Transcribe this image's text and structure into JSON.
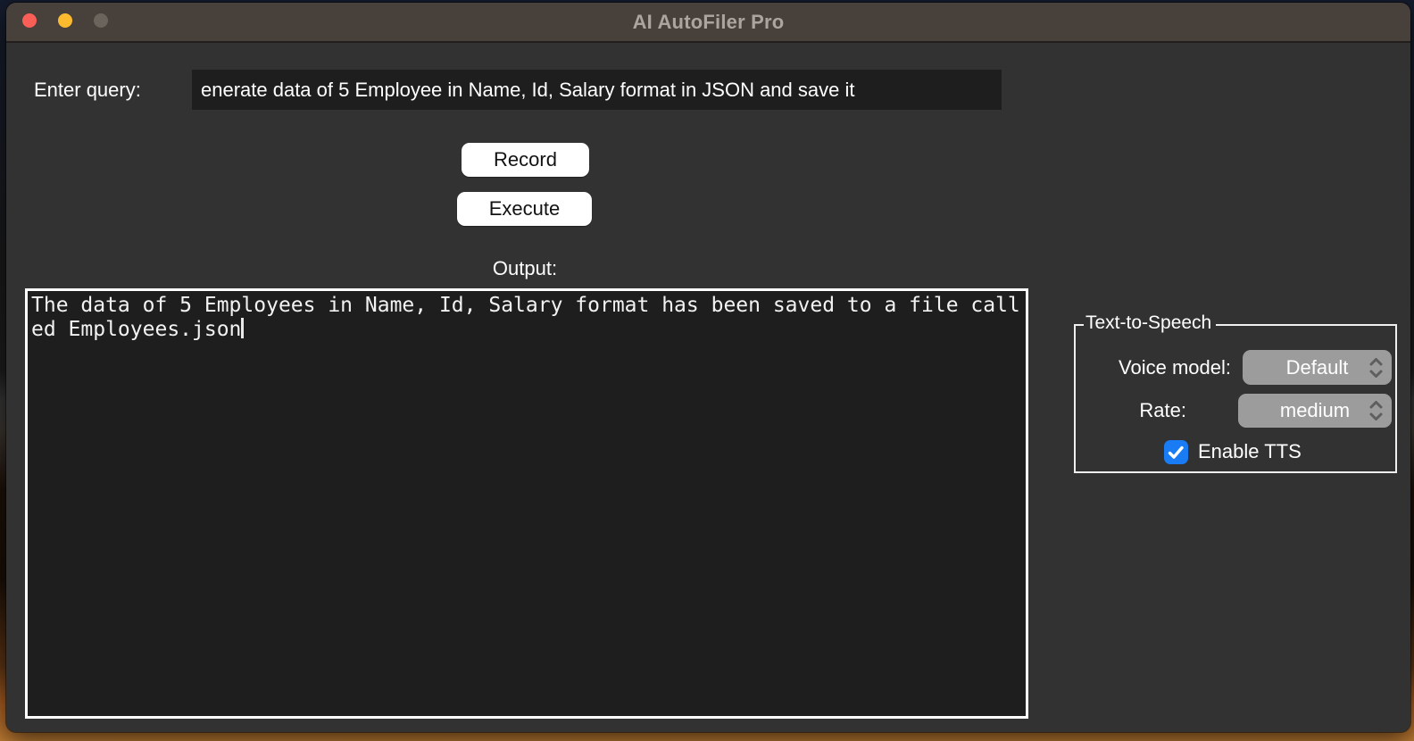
{
  "window": {
    "title": "AI AutoFiler Pro"
  },
  "query": {
    "label": "Enter query:",
    "value": "enerate data of 5 Employee in Name, Id, Salary format in JSON and save it"
  },
  "buttons": {
    "record_label": "Record",
    "execute_label": "Execute"
  },
  "output": {
    "label": "Output:",
    "text": "The data of 5 Employees in Name, Id, Salary format has been saved to a file called Employees.json"
  },
  "tts": {
    "title": "Text-to-Speech",
    "voice_label": "Voice model:",
    "voice_value": "Default",
    "rate_label": "Rate:",
    "rate_value": "medium",
    "enable_label": "Enable TTS",
    "enabled": true
  },
  "colors": {
    "titlebar": "#47403b",
    "window_background": "#323232",
    "field_background": "#1e1e1e",
    "button_background": "#ffffff",
    "combo_background": "#9c9c9c",
    "checkbox_blue": "#1a7cf5",
    "traffic_red": "#f95f57",
    "traffic_yellow": "#fcbb2f",
    "traffic_gray": "#6b645d",
    "desktop_orange": "#a65c22"
  }
}
